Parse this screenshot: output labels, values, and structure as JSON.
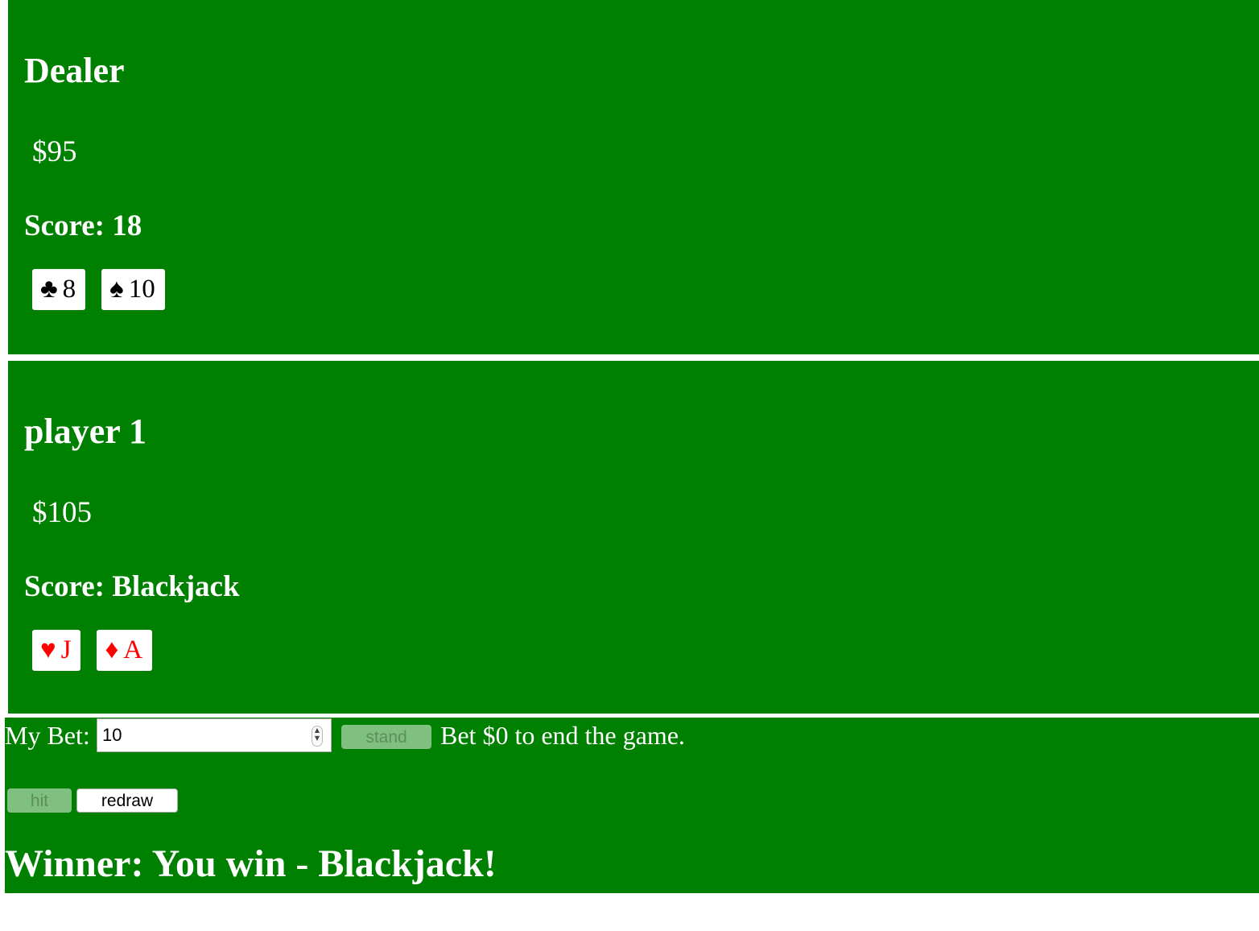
{
  "colors": {
    "table_green": "#008000",
    "text_white": "#ffffff",
    "red_suit": "#ff0000",
    "black_suit": "#000000"
  },
  "dealer": {
    "name": "Dealer",
    "money": "$95",
    "score": "Score: 18",
    "cards": [
      {
        "suit": "♣",
        "rank": "8",
        "color": "black"
      },
      {
        "suit": "♠",
        "rank": "10",
        "color": "black"
      }
    ]
  },
  "player": {
    "name": "player 1",
    "money": "$105",
    "score": "Score: Blackjack",
    "cards": [
      {
        "suit": "♥",
        "rank": "J",
        "color": "red"
      },
      {
        "suit": "♦",
        "rank": "A",
        "color": "red"
      }
    ]
  },
  "controls": {
    "bet_label": "My Bet:",
    "bet_value": "10",
    "stand_label": "stand",
    "hint": "Bet $0 to end the game.",
    "hit_label": "hit",
    "redraw_label": "redraw",
    "winner": "Winner: You win - Blackjack!"
  }
}
